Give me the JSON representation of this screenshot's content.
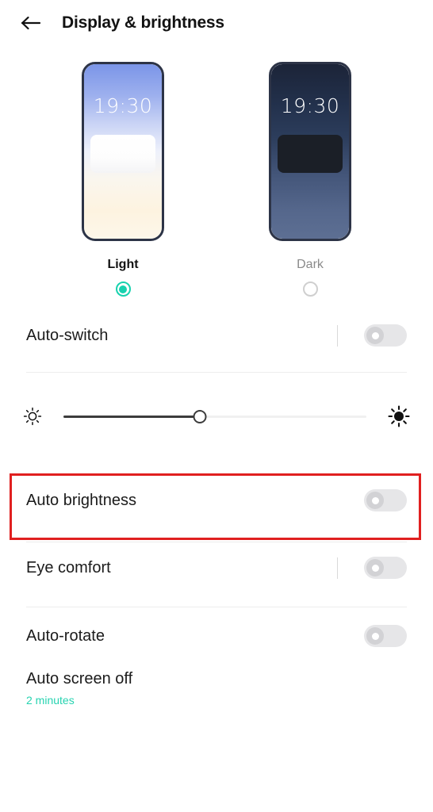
{
  "header": {
    "back_icon": "back-arrow-icon",
    "title": "Display & brightness"
  },
  "theme": {
    "clock_time": "19:30",
    "options": [
      {
        "label": "Light",
        "selected": true,
        "radio_icon": "radio-selected-icon"
      },
      {
        "label": "Dark",
        "selected": false,
        "radio_icon": "radio-unselected-icon"
      }
    ],
    "accent_color": "#17d2ae"
  },
  "rows": {
    "auto_switch": {
      "label": "Auto-switch",
      "toggle_state": "off",
      "has_divider": true
    },
    "auto_brightness": {
      "label": "Auto brightness",
      "toggle_state": "off",
      "highlighted": true,
      "highlight_color": "#e02020"
    },
    "eye_comfort": {
      "label": "Eye comfort",
      "toggle_state": "off",
      "has_divider": true
    },
    "auto_rotate": {
      "label": "Auto-rotate",
      "toggle_state": "off",
      "has_divider": false
    },
    "auto_screen_off": {
      "label": "Auto screen off",
      "value": "2 minutes",
      "value_color": "#26d3b0"
    }
  },
  "brightness": {
    "low_icon": "sun-outline-icon",
    "high_icon": "sun-filled-icon",
    "value_percent": 45
  }
}
